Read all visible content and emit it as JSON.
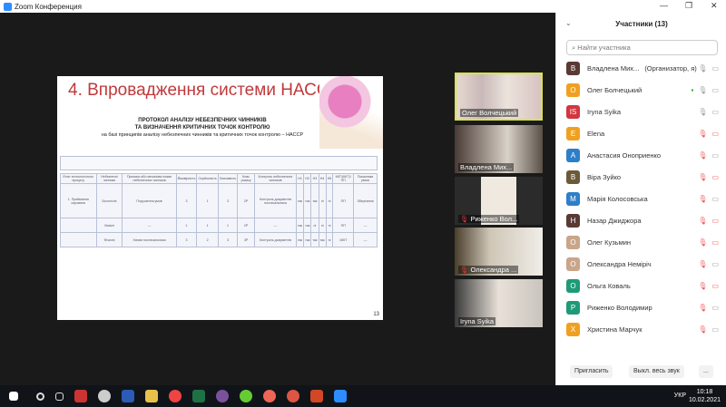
{
  "window": {
    "title": "Zoom Конференция"
  },
  "slide": {
    "title": "4. Впровадження системи НАССР",
    "protocol_line1": "ПРОТОКОЛ АНАЛІЗУ НЕБЕЗПЕЧНИХ ЧИННИКІВ",
    "protocol_line2": "ТА ВИЗНАЧЕННЯ КРИТИЧНИХ ТОЧОК КОНТРОЛЮ",
    "protocol_line3": "на базі принципів аналізу небезпечних чинників та критичних точок контролю – НАССР",
    "page": "13",
    "table_headers": [
      "Етап технологічного процесу",
      "Небезпечні чинники",
      "Причини або механізмі появи небезпечних чинників",
      "Ймовірність",
      "Серйозність",
      "Значимість",
      "Клас ризику",
      "Контроль небезпечних чинників",
      "Н1",
      "Н2",
      "Н3",
      "Н4",
      "Н5",
      "ККТ/(ККТ)/ПП",
      "Показники уваги"
    ],
    "rows": [
      {
        "stage": "1. Приймання сировини",
        "hazard": "Біологічні",
        "cause": "Порушення умов",
        "v": [
          "3",
          "1",
          "3",
          "2Р"
        ],
        "control": "Контроль документів постачальника",
        "h": [
          "так",
          "так",
          "так",
          "ні",
          "ні"
        ],
        "ccp": "ПП",
        "note": "Зберігання"
      },
      {
        "stage": "",
        "hazard": "Хімічні",
        "cause": "—",
        "v": [
          "1",
          "1",
          "1",
          "2Р"
        ],
        "control": "—",
        "h": [
          "так",
          "так",
          "ні",
          "ні",
          "ні"
        ],
        "ccp": "ПП",
        "note": "—"
      },
      {
        "stage": "",
        "hazard": "Фізичні",
        "cause": "Умови постачальника",
        "v": [
          "3",
          "2",
          "3",
          "3Р"
        ],
        "control": "Контроль документів",
        "h": [
          "так",
          "так",
          "так",
          "так",
          "ні"
        ],
        "ccp": "1ККТ",
        "note": "—"
      }
    ]
  },
  "video_tiles": [
    {
      "name": "Олег Волчецький",
      "muted": false,
      "active": true
    },
    {
      "name": "Владлена Мих...",
      "muted": false
    },
    {
      "name": "Риженко Вол...",
      "muted": true
    },
    {
      "name": "Олександра ...",
      "muted": true
    },
    {
      "name": "Iryna Syika",
      "muted": false
    }
  ],
  "panel": {
    "title": "Участники (13)",
    "search_placeholder": "Найти участника",
    "participants": [
      {
        "initial": "В",
        "name": "Владлена Мих...",
        "role": "(Организатор, я)",
        "color": "#5a3a35",
        "muted": false,
        "video": false
      },
      {
        "initial": "О",
        "name": "Олег Болчецький",
        "color": "#f0a020",
        "muted": false,
        "video": true
      },
      {
        "initial": "IS",
        "name": "Iryna Syika",
        "color": "#d2373f",
        "muted": false,
        "video": false
      },
      {
        "initial": "E",
        "name": "Elena",
        "color": "#f0a020",
        "muted": true,
        "video": false
      },
      {
        "initial": "A",
        "name": "Анастасия Оноприенко",
        "color": "#2d7fc8",
        "muted": true,
        "video": false
      },
      {
        "initial": "В",
        "name": "Віра Зуйко",
        "color": "#6b5a3a",
        "muted": true,
        "video": false
      },
      {
        "initial": "M",
        "name": "Марія Колосовська",
        "color": "#2d7fc8",
        "muted": true,
        "video": false
      },
      {
        "initial": "H",
        "name": "Назар Джиджора",
        "color": "#5a3a35",
        "muted": true,
        "video": false
      },
      {
        "initial": "О",
        "name": "Олег Кузьмин",
        "color": "#c9a58a",
        "muted": true,
        "video": false
      },
      {
        "initial": "О",
        "name": "Олександра Немірiч",
        "color": "#c9a58a",
        "muted": true,
        "video": false
      },
      {
        "initial": "O",
        "name": "Ольга Коваль",
        "color": "#1f9a78",
        "muted": true,
        "video": false
      },
      {
        "initial": "P",
        "name": "Риженко Володимир",
        "color": "#1f9a78",
        "muted": true,
        "video": false
      },
      {
        "initial": "X",
        "name": "Христина Марчук",
        "color": "#f0a020",
        "muted": true,
        "video": false
      }
    ],
    "invite": "Пригласить",
    "mute_all": "Выкл. весь звук",
    "more": "..."
  },
  "taskbar": {
    "lang": "УКР",
    "time": "10:18",
    "date": "10.02.2021"
  }
}
